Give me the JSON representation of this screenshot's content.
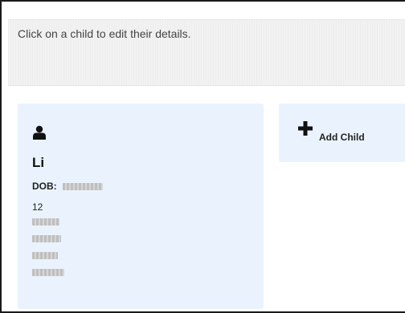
{
  "instructions": "Click on a child to edit their details.",
  "child": {
    "name": "Li",
    "dob_label": "DOB:",
    "age": "12",
    "icon": "person-icon"
  },
  "add_child": {
    "label": "Add Child",
    "icon": "plus-icon"
  },
  "colors": {
    "card_background": "#eaf3fd",
    "banner_background": "#f2f2f2"
  }
}
